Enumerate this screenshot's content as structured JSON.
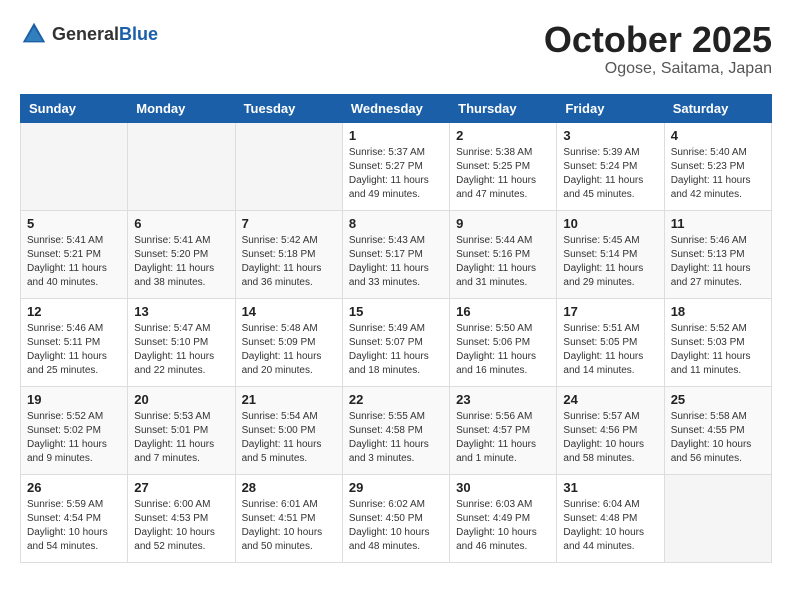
{
  "header": {
    "logo_general": "General",
    "logo_blue": "Blue",
    "month": "October 2025",
    "location": "Ogose, Saitama, Japan"
  },
  "weekdays": [
    "Sunday",
    "Monday",
    "Tuesday",
    "Wednesday",
    "Thursday",
    "Friday",
    "Saturday"
  ],
  "weeks": [
    [
      {
        "day": "",
        "info": ""
      },
      {
        "day": "",
        "info": ""
      },
      {
        "day": "",
        "info": ""
      },
      {
        "day": "1",
        "info": "Sunrise: 5:37 AM\nSunset: 5:27 PM\nDaylight: 11 hours\nand 49 minutes."
      },
      {
        "day": "2",
        "info": "Sunrise: 5:38 AM\nSunset: 5:25 PM\nDaylight: 11 hours\nand 47 minutes."
      },
      {
        "day": "3",
        "info": "Sunrise: 5:39 AM\nSunset: 5:24 PM\nDaylight: 11 hours\nand 45 minutes."
      },
      {
        "day": "4",
        "info": "Sunrise: 5:40 AM\nSunset: 5:23 PM\nDaylight: 11 hours\nand 42 minutes."
      }
    ],
    [
      {
        "day": "5",
        "info": "Sunrise: 5:41 AM\nSunset: 5:21 PM\nDaylight: 11 hours\nand 40 minutes."
      },
      {
        "day": "6",
        "info": "Sunrise: 5:41 AM\nSunset: 5:20 PM\nDaylight: 11 hours\nand 38 minutes."
      },
      {
        "day": "7",
        "info": "Sunrise: 5:42 AM\nSunset: 5:18 PM\nDaylight: 11 hours\nand 36 minutes."
      },
      {
        "day": "8",
        "info": "Sunrise: 5:43 AM\nSunset: 5:17 PM\nDaylight: 11 hours\nand 33 minutes."
      },
      {
        "day": "9",
        "info": "Sunrise: 5:44 AM\nSunset: 5:16 PM\nDaylight: 11 hours\nand 31 minutes."
      },
      {
        "day": "10",
        "info": "Sunrise: 5:45 AM\nSunset: 5:14 PM\nDaylight: 11 hours\nand 29 minutes."
      },
      {
        "day": "11",
        "info": "Sunrise: 5:46 AM\nSunset: 5:13 PM\nDaylight: 11 hours\nand 27 minutes."
      }
    ],
    [
      {
        "day": "12",
        "info": "Sunrise: 5:46 AM\nSunset: 5:11 PM\nDaylight: 11 hours\nand 25 minutes."
      },
      {
        "day": "13",
        "info": "Sunrise: 5:47 AM\nSunset: 5:10 PM\nDaylight: 11 hours\nand 22 minutes."
      },
      {
        "day": "14",
        "info": "Sunrise: 5:48 AM\nSunset: 5:09 PM\nDaylight: 11 hours\nand 20 minutes."
      },
      {
        "day": "15",
        "info": "Sunrise: 5:49 AM\nSunset: 5:07 PM\nDaylight: 11 hours\nand 18 minutes."
      },
      {
        "day": "16",
        "info": "Sunrise: 5:50 AM\nSunset: 5:06 PM\nDaylight: 11 hours\nand 16 minutes."
      },
      {
        "day": "17",
        "info": "Sunrise: 5:51 AM\nSunset: 5:05 PM\nDaylight: 11 hours\nand 14 minutes."
      },
      {
        "day": "18",
        "info": "Sunrise: 5:52 AM\nSunset: 5:03 PM\nDaylight: 11 hours\nand 11 minutes."
      }
    ],
    [
      {
        "day": "19",
        "info": "Sunrise: 5:52 AM\nSunset: 5:02 PM\nDaylight: 11 hours\nand 9 minutes."
      },
      {
        "day": "20",
        "info": "Sunrise: 5:53 AM\nSunset: 5:01 PM\nDaylight: 11 hours\nand 7 minutes."
      },
      {
        "day": "21",
        "info": "Sunrise: 5:54 AM\nSunset: 5:00 PM\nDaylight: 11 hours\nand 5 minutes."
      },
      {
        "day": "22",
        "info": "Sunrise: 5:55 AM\nSunset: 4:58 PM\nDaylight: 11 hours\nand 3 minutes."
      },
      {
        "day": "23",
        "info": "Sunrise: 5:56 AM\nSunset: 4:57 PM\nDaylight: 11 hours\nand 1 minute."
      },
      {
        "day": "24",
        "info": "Sunrise: 5:57 AM\nSunset: 4:56 PM\nDaylight: 10 hours\nand 58 minutes."
      },
      {
        "day": "25",
        "info": "Sunrise: 5:58 AM\nSunset: 4:55 PM\nDaylight: 10 hours\nand 56 minutes."
      }
    ],
    [
      {
        "day": "26",
        "info": "Sunrise: 5:59 AM\nSunset: 4:54 PM\nDaylight: 10 hours\nand 54 minutes."
      },
      {
        "day": "27",
        "info": "Sunrise: 6:00 AM\nSunset: 4:53 PM\nDaylight: 10 hours\nand 52 minutes."
      },
      {
        "day": "28",
        "info": "Sunrise: 6:01 AM\nSunset: 4:51 PM\nDaylight: 10 hours\nand 50 minutes."
      },
      {
        "day": "29",
        "info": "Sunrise: 6:02 AM\nSunset: 4:50 PM\nDaylight: 10 hours\nand 48 minutes."
      },
      {
        "day": "30",
        "info": "Sunrise: 6:03 AM\nSunset: 4:49 PM\nDaylight: 10 hours\nand 46 minutes."
      },
      {
        "day": "31",
        "info": "Sunrise: 6:04 AM\nSunset: 4:48 PM\nDaylight: 10 hours\nand 44 minutes."
      },
      {
        "day": "",
        "info": ""
      }
    ]
  ]
}
